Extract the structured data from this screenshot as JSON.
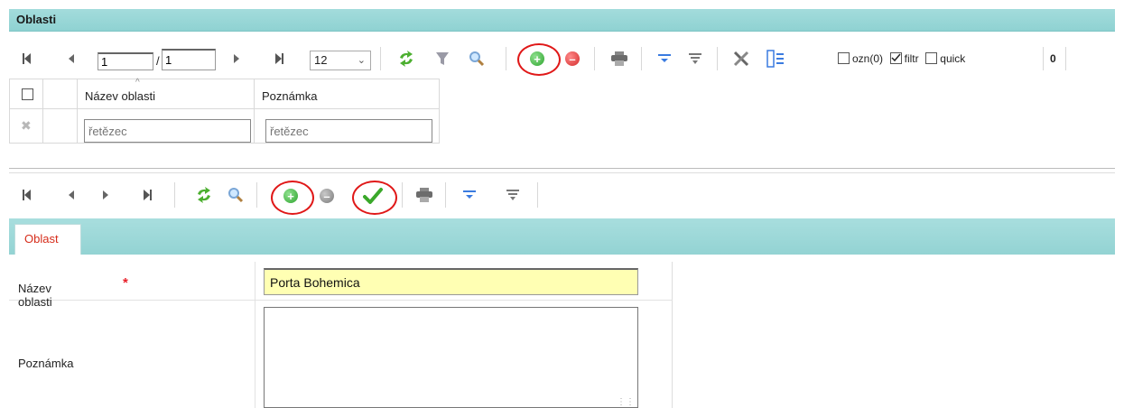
{
  "window": {
    "title": "Oblasti"
  },
  "grid_toolbar": {
    "current_page": "1",
    "page_separator": "/",
    "total_pages": "1",
    "page_size": "12",
    "checkboxes": [
      {
        "label": "ozn(0)",
        "checked": false
      },
      {
        "label": "filtr",
        "checked": true
      },
      {
        "label": "quick",
        "checked": false
      }
    ],
    "count": "0"
  },
  "grid": {
    "columns": [
      "Název oblasti",
      "Poznámka"
    ],
    "filter_placeholders": [
      "řetězec",
      "řetězec"
    ]
  },
  "tabs": [
    {
      "label": "Oblast",
      "active": true
    }
  ],
  "form": {
    "name_label": "Název oblasti",
    "required_marker": "*",
    "name_value": "Porta Bohemica",
    "note_label": "Poznámka",
    "note_value": ""
  },
  "colors": {
    "header_teal": "#96d5d5",
    "highlight_ring": "#e01818",
    "input_yellow": "#ffffb3",
    "required_red": "#e8202a",
    "tab_text_red": "#d62c1a"
  },
  "icons": {
    "toolbar_top": [
      "first-page-icon",
      "prev-page-icon",
      "next-page-icon",
      "last-page-icon",
      "refresh-icon",
      "filter-icon",
      "search-icon",
      "add-icon",
      "delete-icon",
      "print-icon",
      "sort-asc-icon",
      "sort-desc-icon",
      "tools-icon",
      "columns-icon"
    ],
    "toolbar_bottom": [
      "first-record-icon",
      "prev-record-icon",
      "next-record-icon",
      "last-record-icon",
      "refresh-icon",
      "search-icon",
      "add-icon",
      "cancel-icon",
      "save-check-icon",
      "print-icon",
      "sort-asc-icon",
      "sort-desc-icon"
    ]
  }
}
